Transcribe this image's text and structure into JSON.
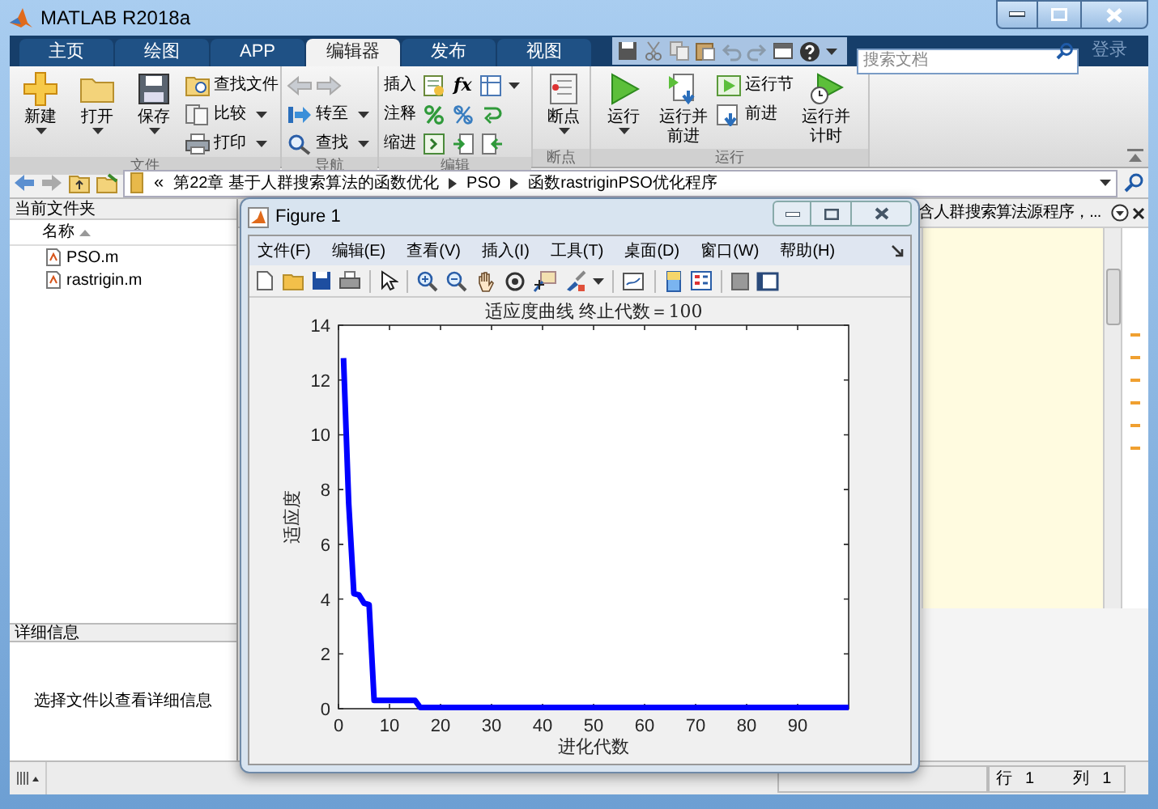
{
  "window": {
    "title": "MATLAB R2018a"
  },
  "tabs": [
    {
      "label": "主页",
      "selected": false
    },
    {
      "label": "绘图",
      "selected": false
    },
    {
      "label": "APP",
      "selected": false
    },
    {
      "label": "编辑器",
      "selected": true
    },
    {
      "label": "发布",
      "selected": false
    },
    {
      "label": "视图",
      "selected": false
    }
  ],
  "search": {
    "placeholder": "搜索文档"
  },
  "login": "登录",
  "toolstrip": [
    {
      "title": "文件",
      "items": [
        {
          "kind": "large",
          "label": "新建",
          "dropdown": true
        },
        {
          "kind": "large",
          "label": "打开",
          "dropdown": true
        },
        {
          "kind": "large",
          "label": "保存",
          "dropdown": true
        },
        {
          "kind": "small",
          "label": "查找文件",
          "dropdown": false
        },
        {
          "kind": "small",
          "label": "比较",
          "dropdown": true
        },
        {
          "kind": "small",
          "label": "打印",
          "dropdown": true
        }
      ]
    },
    {
      "title": "导航",
      "items": [
        {
          "kind": "arrows"
        },
        {
          "kind": "small",
          "label": "转至",
          "dropdown": true
        },
        {
          "kind": "small",
          "label": "查找",
          "dropdown": true
        }
      ]
    },
    {
      "title": "编辑",
      "items": [
        {
          "kind": "row",
          "label": "插入",
          "glyph": "fx",
          "dropdown": true
        },
        {
          "kind": "row",
          "label": "注释",
          "dropdown": false
        },
        {
          "kind": "row",
          "label": "缩进",
          "dropdown": false
        }
      ]
    },
    {
      "title": "断点",
      "items": [
        {
          "kind": "large",
          "label": "断点",
          "dropdown": true
        }
      ]
    },
    {
      "title": "运行",
      "items": [
        {
          "kind": "large",
          "label": "运行",
          "dropdown": true
        },
        {
          "kind": "large",
          "label": "运行并前进",
          "dropdown": false
        },
        {
          "kind": "small",
          "label": "运行节",
          "dropdown": false
        },
        {
          "kind": "small",
          "label": "前进",
          "dropdown": false
        },
        {
          "kind": "large",
          "label": "运行并计时",
          "dropdown": false
        }
      ]
    }
  ],
  "address": {
    "prefix": "«",
    "segments": [
      "第22章 基于人群搜索算法的函数优化",
      "PSO",
      "函数rastriginPSO优化程序"
    ]
  },
  "current_folder": {
    "title": "当前文件夹",
    "column": "名称",
    "files": [
      "PSO.m",
      "rastrigin.m"
    ]
  },
  "details": {
    "title": "详细信息",
    "message": "选择文件以查看详细信息"
  },
  "editor": {
    "title": "含人群搜索算法源程序，..."
  },
  "status_bar": {
    "row_label": "行",
    "row": "1",
    "column_label": "列",
    "column": "1"
  },
  "figure": {
    "title": "Figure 1",
    "menu": [
      "文件(F)",
      "编辑(E)",
      "查看(V)",
      "插入(I)",
      "工具(T)",
      "桌面(D)",
      "窗口(W)",
      "帮助(H)"
    ],
    "chart_data": {
      "type": "line",
      "title": "适应度曲线 终止代数＝100",
      "xlabel": "进化代数",
      "ylabel": "适应度",
      "xlim": [
        0,
        100
      ],
      "ylim": [
        0,
        14
      ],
      "xticks": [
        0,
        10,
        20,
        30,
        40,
        50,
        60,
        70,
        80,
        90
      ],
      "yticks": [
        0,
        2,
        4,
        6,
        8,
        10,
        12,
        14
      ],
      "x": [
        1,
        2,
        3,
        4,
        5,
        6,
        7,
        14,
        15,
        16,
        100
      ],
      "series": [
        {
          "color": "#0000ff",
          "values": [
            12.8,
            7.5,
            4.2,
            4.15,
            3.85,
            3.8,
            0.3,
            0.3,
            0.3,
            0.05,
            0.05
          ]
        }
      ]
    }
  }
}
